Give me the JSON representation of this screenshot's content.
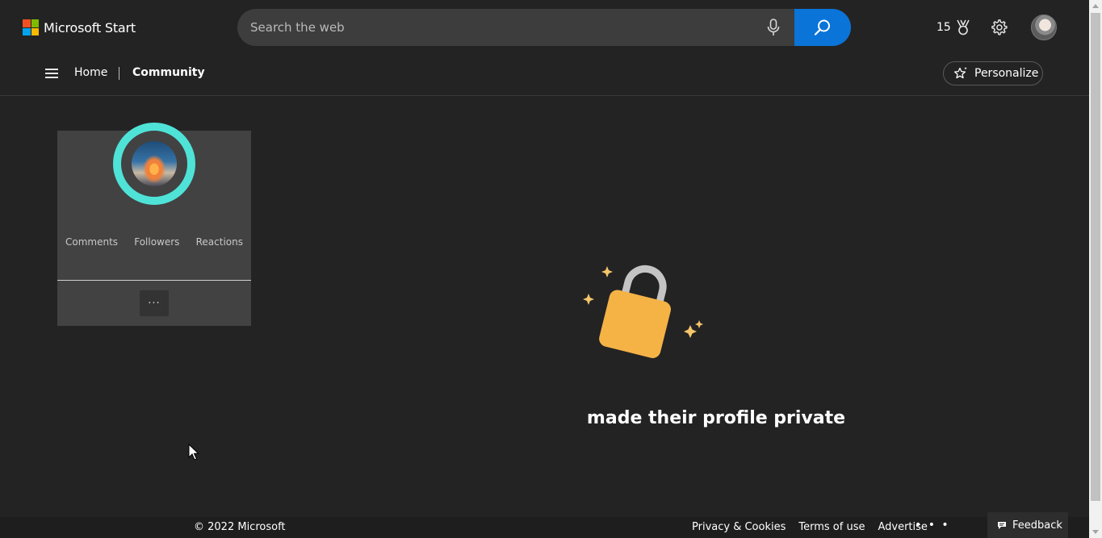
{
  "header": {
    "brand_name": "Microsoft Start",
    "logo_colors": [
      "#f25022",
      "#7fba00",
      "#00a4ef",
      "#ffb900"
    ],
    "search_placeholder": "Search the web",
    "search_icon": "search-icon",
    "mic_icon": "microphone-icon",
    "rewards_count": "15",
    "rewards_icon": "medal-icon",
    "settings_icon": "gear-icon",
    "accent_color": "#0a74d8"
  },
  "subnav": {
    "menu_icon": "hamburger-icon",
    "home_label": "Home",
    "community_label": "Community",
    "personalize_label": "Personalize",
    "personalize_icon": "star-sparkle-icon"
  },
  "profile_card": {
    "ring_color": "#4fe3d8",
    "stats": {
      "comments_label": "Comments",
      "followers_label": "Followers",
      "reactions_label": "Reactions"
    },
    "more_label": "···"
  },
  "notice": {
    "icon": "padlock-icon",
    "message": "made their profile private"
  },
  "footer": {
    "copyright": "© 2022 Microsoft",
    "links": [
      "Privacy & Cookies",
      "Terms of use",
      "Advertise"
    ],
    "more_label": "• • •",
    "feedback_label": "Feedback",
    "feedback_icon": "feedback-icon"
  }
}
